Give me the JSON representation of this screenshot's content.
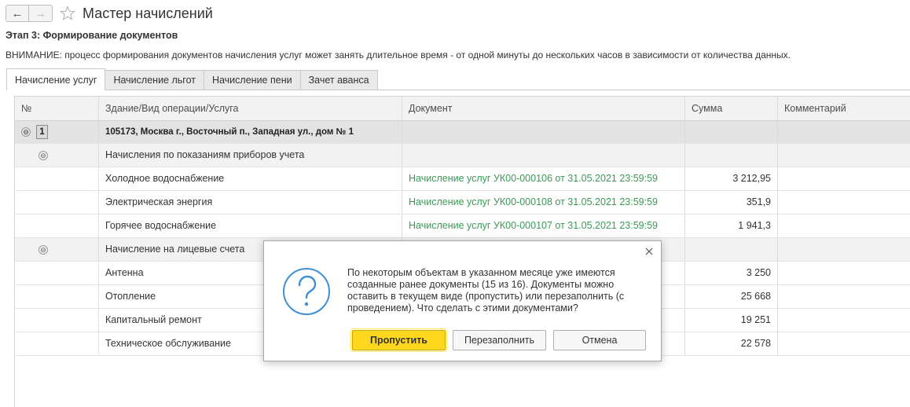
{
  "window": {
    "title": "Мастер начислений"
  },
  "stage": "Этап 3: Формирование документов",
  "warning": "ВНИМАНИЕ: процесс формирования документов начисления услуг может занять длительное время - от одной минуты до нескольких часов в зависимости от количества данных.",
  "tabs": [
    "Начисление услуг",
    "Начисление льгот",
    "Начисление пени",
    "Зачет аванса"
  ],
  "table": {
    "columns": [
      "№",
      "Здание/Вид операции/Услуга",
      "Документ",
      "Сумма",
      "Комментарий"
    ],
    "building": {
      "num": "1",
      "toggle": "⊖",
      "name": "105173, Москва г., Восточный п., Западная ул., дом № 1"
    },
    "rows": [
      {
        "toggle": "⊖",
        "name": "Начисления по показаниям приборов учета",
        "doc": "",
        "sum": ""
      },
      {
        "toggle": "",
        "name": "Холодное водоснабжение",
        "doc": "Начисление услуг УК00-000106 от 31.05.2021 23:59:59",
        "sum": "3 212,95"
      },
      {
        "toggle": "",
        "name": "Электрическая энергия",
        "doc": "Начисление услуг УК00-000108 от 31.05.2021 23:59:59",
        "sum": "351,9"
      },
      {
        "toggle": "",
        "name": "Горячее водоснабжение",
        "doc": "Начисление услуг УК00-000107 от 31.05.2021 23:59:59",
        "sum": "1 941,3"
      },
      {
        "toggle": "⊖",
        "name": "Начисление на лицевые счета",
        "doc": "",
        "sum": ""
      },
      {
        "toggle": "",
        "name": "Антенна",
        "doc": "",
        "sum": "3 250"
      },
      {
        "toggle": "",
        "name": "Отопление",
        "doc": "",
        "sum": "25 668"
      },
      {
        "toggle": "",
        "name": "Капитальный ремонт",
        "doc": "",
        "sum": "19 251"
      },
      {
        "toggle": "",
        "name": "Техническое обслуживание",
        "doc": "",
        "sum": "22 578"
      }
    ]
  },
  "dialog": {
    "message": "По некоторым объектам в указанном месяце уже имеются созданные ранее документы (15 из 16). Документы можно оставить в текущем виде (пропустить) или перезаполнить (с проведением). Что сделать с этими документами?",
    "buttons": {
      "skip": "Пропустить",
      "refill": "Перезаполнить",
      "cancel": "Отмена"
    }
  },
  "icons": {
    "back": "arrow-left-icon",
    "forward": "arrow-right-icon",
    "favorite": "star-icon",
    "close": "close-icon",
    "question": "question-icon"
  },
  "colors": {
    "accent": "#ffd71f",
    "link": "#3a9a55",
    "header_bg": "#f2f2f2",
    "building_bg": "#e3e3e3"
  }
}
